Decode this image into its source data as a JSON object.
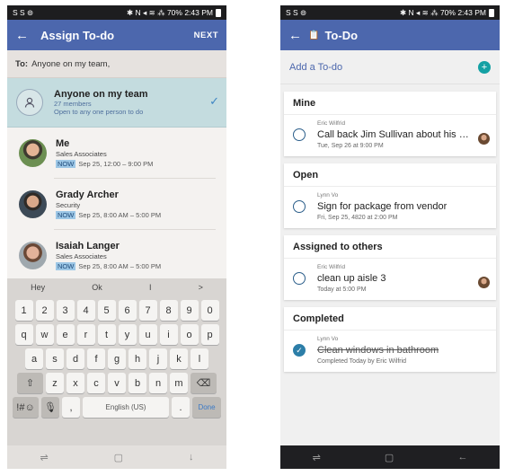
{
  "left": {
    "status": {
      "left": "S S ⊚",
      "right": "✱ N ◂ ≋ ⁂ 70% 2:43 PM"
    },
    "appbar": {
      "title": "Assign To-do",
      "next": "NEXT"
    },
    "to": {
      "label": "To:",
      "value": "Anyone on my team,"
    },
    "team": {
      "name": "Anyone on my team",
      "members": "27 members",
      "desc": "Open to any one person to do"
    },
    "people": [
      {
        "name": "Me",
        "role": "Sales Associates",
        "now": "NOW",
        "time": "Sep 25, 12:00 – 9:00 PM"
      },
      {
        "name": "Grady Archer",
        "role": "Security",
        "now": "NOW",
        "time": "Sep 25, 8:00 AM – 5:00 PM"
      },
      {
        "name": "Isaiah Langer",
        "role": "Sales Associates",
        "now": "NOW",
        "time": "Sep 25, 8:00 AM – 5:00 PM"
      }
    ],
    "keyboard": {
      "suggestions": [
        "Hey",
        "Ok",
        "I",
        ">"
      ],
      "row1": [
        "1",
        "2",
        "3",
        "4",
        "5",
        "6",
        "7",
        "8",
        "9",
        "0"
      ],
      "row2": [
        "q",
        "w",
        "e",
        "r",
        "t",
        "y",
        "u",
        "i",
        "o",
        "p"
      ],
      "row3": [
        "a",
        "s",
        "d",
        "f",
        "g",
        "h",
        "j",
        "k",
        "l"
      ],
      "row4": [
        "⇧",
        "z",
        "x",
        "c",
        "v",
        "b",
        "n",
        "m",
        "⌫"
      ],
      "sym": "!#☺",
      "mic": "🎙",
      "comma": ",",
      "space": "English (US)",
      "period": ".",
      "done": "Done"
    },
    "nav": [
      "⇌",
      "▢",
      "↓"
    ]
  },
  "right": {
    "status": {
      "left": "S S ⊚",
      "right": "✱ N ◂ ≋ ⁂ 70% 2:43 PM"
    },
    "appbar": {
      "title": "To-Do",
      "icon": "📋"
    },
    "add": {
      "label": "Add a To-do",
      "plus": "+"
    },
    "sections": [
      {
        "title": "Mine",
        "items": [
          {
            "author": "Eric Wilfrid",
            "title": "Call back Jim Sullivan about his on...",
            "meta": "Tue, Sep 26 at 9:00 PM",
            "done": false,
            "avatar": true
          }
        ]
      },
      {
        "title": "Open",
        "items": [
          {
            "author": "Lynn Vo",
            "title": "Sign for package from vendor",
            "meta": "Fri, Sep 25, 4820 at 2:00 PM",
            "done": false,
            "avatar": false
          }
        ]
      },
      {
        "title": "Assigned to others",
        "items": [
          {
            "author": "Eric Wilfrid",
            "title": "clean up aisle 3",
            "meta": "Today at 5:00 PM",
            "done": false,
            "avatar": true
          }
        ]
      },
      {
        "title": "Completed",
        "items": [
          {
            "author": "Lynn Vo",
            "title": "Clean windows in bathroom",
            "meta": "Completed Today by Eric Wilfrid",
            "done": true,
            "avatar": false
          }
        ]
      }
    ],
    "nav": [
      "⇌",
      "▢",
      "←"
    ]
  }
}
